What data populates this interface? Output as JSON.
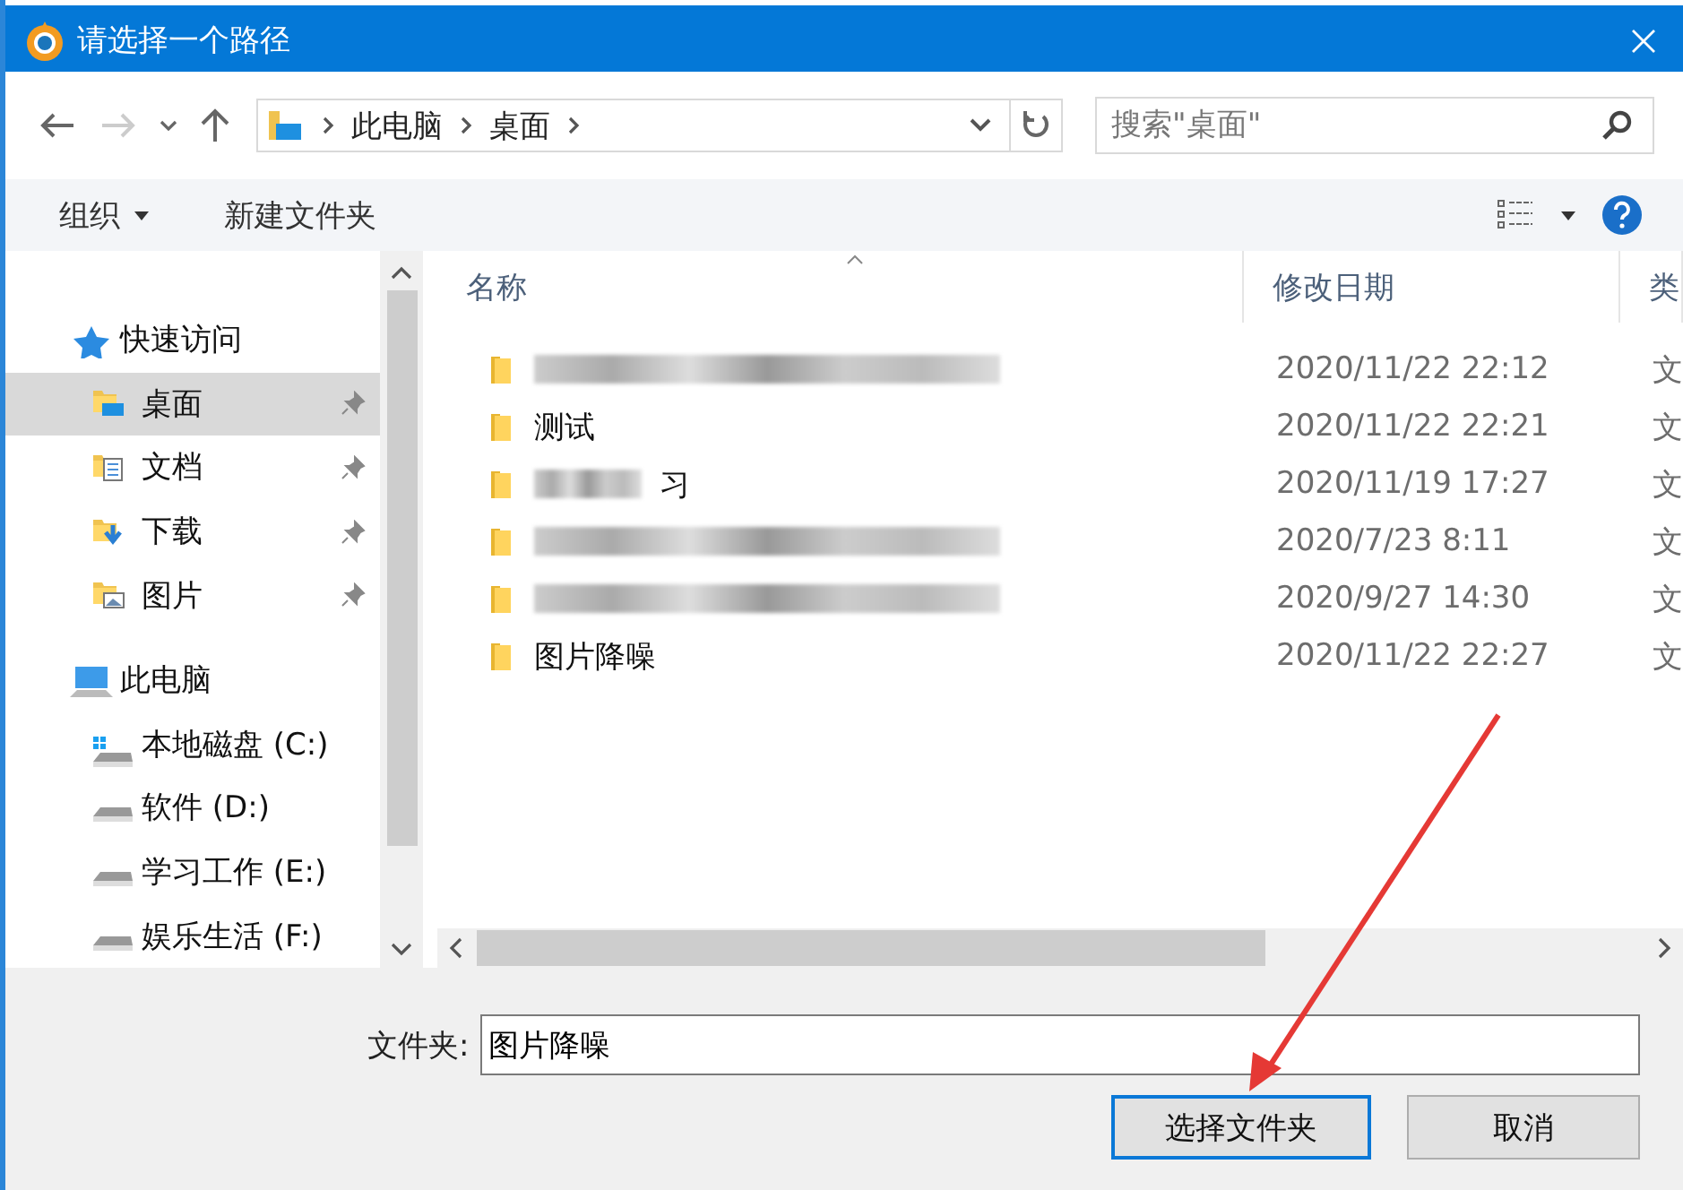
{
  "window": {
    "title": "请选择一个路径"
  },
  "address_bar": {
    "segments": [
      "此电脑",
      "桌面"
    ]
  },
  "search": {
    "placeholder": "搜索\"桌面\""
  },
  "toolbar": {
    "organize": "组织",
    "new_folder": "新建文件夹"
  },
  "sidebar": {
    "items": [
      {
        "kind": "quickaccess",
        "label": "快速访问",
        "selected": false
      },
      {
        "kind": "desktop",
        "label": "桌面",
        "selected": true,
        "pinned": true
      },
      {
        "kind": "documents",
        "label": "文档",
        "selected": false,
        "pinned": true
      },
      {
        "kind": "downloads",
        "label": "下载",
        "selected": false,
        "pinned": true
      },
      {
        "kind": "pictures",
        "label": "图片",
        "selected": false,
        "pinned": true
      },
      {
        "kind": "thispc",
        "label": "此电脑",
        "selected": false
      },
      {
        "kind": "systemdrive",
        "label": "本地磁盘 (C:)",
        "selected": false
      },
      {
        "kind": "drive",
        "label": "软件 (D:)",
        "selected": false
      },
      {
        "kind": "drive",
        "label": "学习工作 (E:)",
        "selected": false
      },
      {
        "kind": "drive",
        "label": "娱乐生活 (F:)",
        "selected": false
      }
    ]
  },
  "file_list": {
    "columns": [
      "名称",
      "修改日期",
      "类"
    ],
    "rows": [
      {
        "blurred": true,
        "modified": "2020/11/22 22:12",
        "column_3": "文"
      },
      {
        "blurred": false,
        "name": "测试",
        "modified": "2020/11/22 22:21",
        "column_3": "文"
      },
      {
        "blurred": true,
        "name": "习",
        "modified": "2020/11/19 17:27",
        "column_3": "文"
      },
      {
        "blurred": true,
        "modified": "2020/7/23 8:11",
        "column_3": "文"
      },
      {
        "blurred": true,
        "modified": "2020/9/27 14:30",
        "column_3": "文"
      },
      {
        "blurred": false,
        "name": "图片降噪",
        "modified": "2020/11/22 22:27",
        "column_3": "文"
      }
    ]
  },
  "folder_field": {
    "label": "文件夹:",
    "value": "图片降噪"
  },
  "buttons": [
    {
      "label": "选择文件夹",
      "default": true
    },
    {
      "label": "取消",
      "default": false
    }
  ]
}
